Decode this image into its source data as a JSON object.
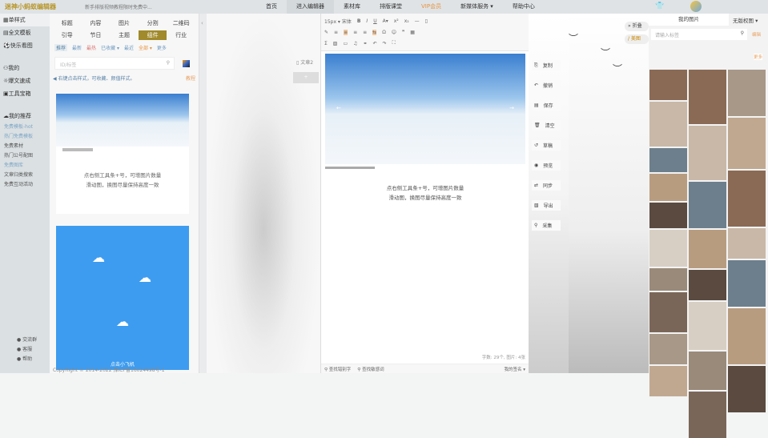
{
  "header": {
    "logo": "迷神小蚂蚁编辑器",
    "notice": "新手排版视频教程限时免费中...",
    "nav": [
      "首页",
      "进入编辑器",
      "素材库",
      "排版课堂",
      "VIP会员",
      "新媒体服务 ▾",
      "帮助中心"
    ]
  },
  "sidebar": {
    "items": [
      "单样式",
      "全文模板",
      "快乐看图",
      "我的",
      "爆文速成",
      "工具宝箱"
    ],
    "recommend": "我的推荐",
    "subs": [
      "免费模板-hot",
      "热门免费模板",
      "免费素材",
      "热门公号配图",
      "免费图库",
      "文章归类搜索",
      "免费互动活动"
    ],
    "bottom": [
      "交流群",
      "客服",
      "帮助"
    ]
  },
  "templates": {
    "categories": [
      "标题",
      "内容",
      "图片",
      "分割",
      "二维码",
      "引导",
      "节日",
      "主题",
      "组件",
      "行业"
    ],
    "active": "组件",
    "filters": [
      "推荐",
      "最新",
      "最热",
      "已收藏 ▾",
      "最近",
      "全部 ▾",
      "更多"
    ],
    "search_placeholder": "ID/标签",
    "tip": "右键点击样式，可收藏、颜值样式。",
    "tip_link": "教程",
    "card_text": [
      "点右侧工具条+号，可增图片数量",
      "滑动图，换图尽量保持高度一致"
    ],
    "card2_label": "点击小飞机",
    "copyright": "CopyRight © 2014-2022 豫ICP备16024498号-1"
  },
  "doc_tab": "文章2",
  "editor": {
    "toolbar_font": "15px ▾  宋体",
    "content": [
      "点右侧工具条+号，可增图片数量",
      "滑动图，换图尽量保持高度一致"
    ],
    "stats": "字数: 29个, 图片: 4张",
    "footer": [
      "查找错别字",
      "查找敏感词"
    ],
    "signature": "我的签名 ▾"
  },
  "menu": [
    "复制",
    "撤销",
    "保存",
    "清空",
    "草稿",
    "预览",
    "同步",
    "导出",
    "采集"
  ],
  "float_buttons": [
    "» 折叠",
    "/ 美图"
  ],
  "images": {
    "tab": "我的图片",
    "dropdown": "无版权图 ▾",
    "search_placeholder": "请输入标签",
    "link": "编辑",
    "more": "更多"
  }
}
